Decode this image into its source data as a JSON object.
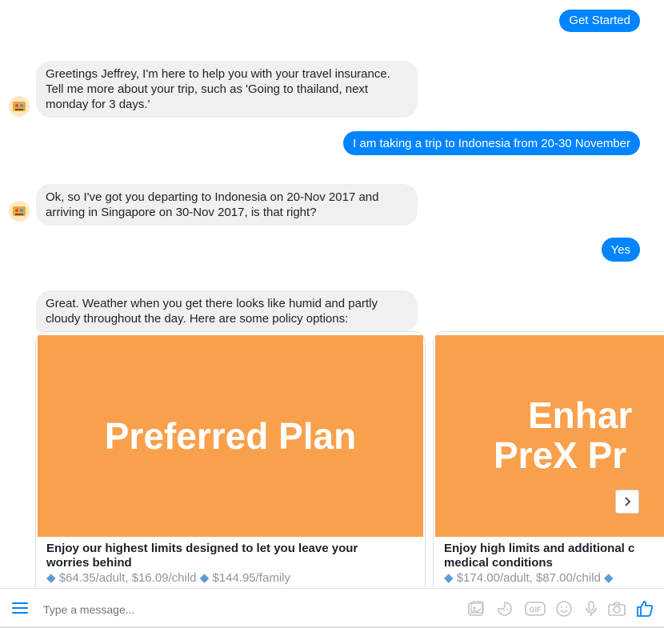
{
  "messages": {
    "m1": "Get Started",
    "m2": "Greetings Jeffrey, I'm here to help you with your travel insurance. Tell me more about your trip, such as 'Going to thailand, next monday for 3 days.'",
    "m3": "I am taking a trip to Indonesia from 20-30 November",
    "m4": "Ok, so I've got you departing to Indonesia on 20-Nov 2017 and arriving in Singapore on 30-Nov 2017, is that right?",
    "m5": "Yes",
    "m6": "Great. Weather when you get there looks like humid and partly cloudy throughout the day. Here are some policy options:"
  },
  "cards": [
    {
      "hero": "Preferred Plan",
      "title": "Enjoy our highest limits designed to let you leave your worries behind",
      "prices": [
        "$64.35/adult, $16.09/child",
        "$144.95/family"
      ]
    },
    {
      "hero_line1": "Enhar",
      "hero_line2": "PreX Pr",
      "title_line1": "Enjoy high limits and additional c",
      "title_line2": "medical conditions",
      "prices": [
        "$174.00/adult, $87.00/child",
        ""
      ]
    }
  ],
  "composer": {
    "placeholder": "Type a message...",
    "icons": [
      "menu-icon",
      "image-icon",
      "sticker-icon",
      "gif-icon",
      "emoji-icon",
      "microphone-icon",
      "camera-icon",
      "like-icon"
    ]
  },
  "colors": {
    "accent": "#0084ff",
    "incoming_bubble": "#f1f0f0",
    "card_hero": "#f9a04d",
    "price_diamond": "#5b9bd5"
  }
}
